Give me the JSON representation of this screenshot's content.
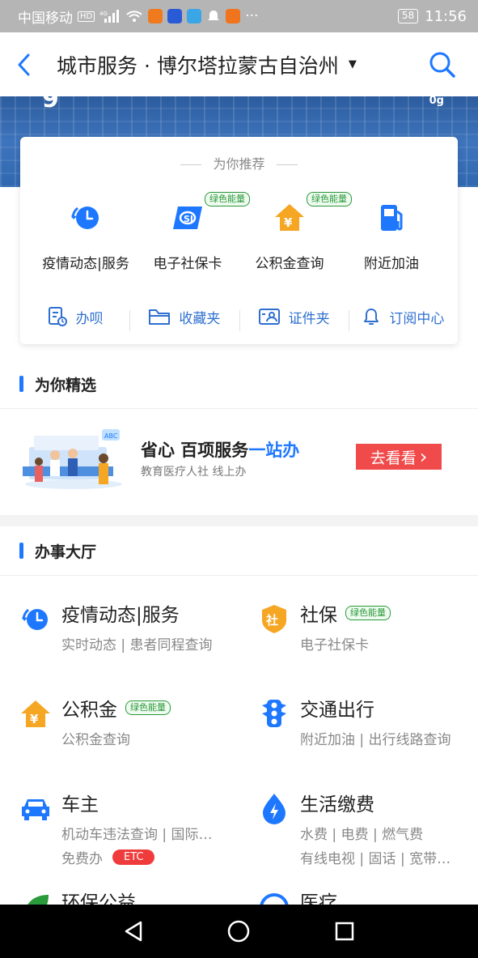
{
  "status_bar": {
    "carrier": "中国移动",
    "battery": "58",
    "time": "11:56",
    "more": "···"
  },
  "header": {
    "title": "城市服务 · 博尔塔拉蒙古自治州",
    "caret": "▼"
  },
  "banner": {
    "glyph_left": "9",
    "glyph_right": "0g"
  },
  "recommend": {
    "title": "为你推荐",
    "items": [
      {
        "label": "疫情动态|服务",
        "icon": "clock-refresh-icon",
        "tag": ""
      },
      {
        "label": "电子社保卡",
        "icon": "social-security-card-icon",
        "tag": "绿色能量"
      },
      {
        "label": "公积金查询",
        "icon": "house-yuan-icon",
        "tag": "绿色能量"
      },
      {
        "label": "附近加油",
        "icon": "fuel-pump-icon",
        "tag": ""
      }
    ],
    "quick": [
      {
        "label": "办呗",
        "icon": "document-clock-icon"
      },
      {
        "label": "收藏夹",
        "icon": "folder-icon"
      },
      {
        "label": "证件夹",
        "icon": "id-card-icon"
      },
      {
        "label": "订阅中心",
        "icon": "bell-icon"
      }
    ]
  },
  "picks": {
    "heading": "为你精选",
    "promo_title_a": "省心 百项服务",
    "promo_title_b": "一站办",
    "promo_sub": "教育医疗人社 线上办",
    "promo_btn": "去看看",
    "promo_btn_arrow": "›",
    "illus_badge": "ABC"
  },
  "hall": {
    "heading": "办事大厅",
    "services": [
      {
        "title": "疫情动态|服务",
        "tag": "",
        "sub": "实时动态 | 患者同程查询",
        "sub2": "",
        "badge": "",
        "icon": "clock-refresh-icon"
      },
      {
        "title": "社保",
        "tag": "绿色能量",
        "sub": "电子社保卡",
        "sub2": "",
        "badge": "",
        "icon": "shield-she-icon"
      },
      {
        "title": "公积金",
        "tag": "绿色能量",
        "sub": "公积金查询",
        "sub2": "",
        "badge": "",
        "icon": "house-yuan-icon"
      },
      {
        "title": "交通出行",
        "tag": "",
        "sub": "附近加油 | 出行线路查询",
        "sub2": "",
        "badge": "",
        "icon": "traffic-light-icon"
      },
      {
        "title": "车主",
        "tag": "",
        "sub": "机动车违法查询 | 国际…",
        "sub2": "免费办",
        "badge": "ETC",
        "icon": "car-icon"
      },
      {
        "title": "生活缴费",
        "tag": "",
        "sub": "水费 | 电费 | 燃气费",
        "sub2": "有线电视 | 固话 | 宽带…",
        "badge": "",
        "icon": "lightning-icon"
      },
      {
        "title": "环保公益",
        "tag": "",
        "sub": "",
        "sub2": "",
        "badge": "",
        "icon": "leaf-icon"
      },
      {
        "title": "医疗",
        "tag": "",
        "sub": "",
        "sub2": "",
        "badge": "",
        "icon": "medical-icon"
      }
    ]
  },
  "colors": {
    "accent": "#1e78ff",
    "green_tag": "#2a9a3a",
    "promo_btn": "#f04a4a",
    "etc_badge": "#ef3b3b"
  }
}
